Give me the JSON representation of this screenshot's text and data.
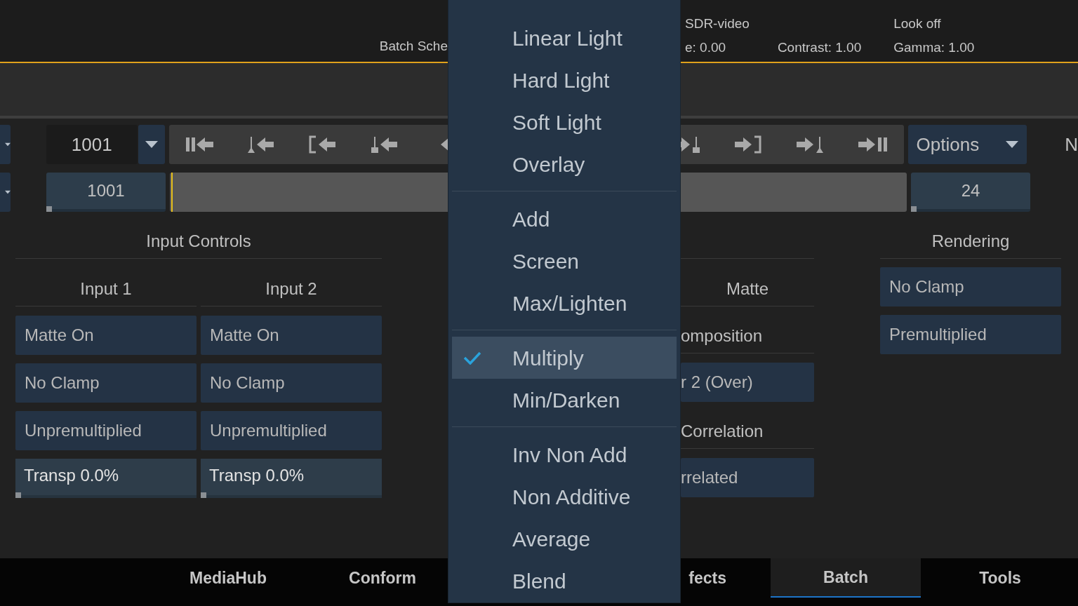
{
  "viewer_info": {
    "batch_label": "Batch Sche",
    "columns": [
      {
        "top": "SDR-video",
        "bottom": "e: 0.00"
      },
      {
        "bottom": "Contrast: 1.00"
      },
      {
        "top": "Look off",
        "bottom": "Gamma: 1.00"
      }
    ]
  },
  "frame_controls": {
    "current_frame": "1001",
    "start_frame": {
      "value": "1001",
      "level": 0
    },
    "end_frame": {
      "value": "24",
      "level": 0
    },
    "options_label": "Options",
    "cut_label": "N"
  },
  "input_controls": {
    "title": "Input Controls",
    "inputs": [
      {
        "title": "Input 1",
        "controls": [
          {
            "kind": "button",
            "label": "Matte On"
          },
          {
            "kind": "button",
            "label": "No Clamp"
          },
          {
            "kind": "button",
            "label": "Unpremultiplied"
          },
          {
            "kind": "slider",
            "label": "Transp 0.0%",
            "level": 0
          }
        ]
      },
      {
        "title": "Input 2",
        "controls": [
          {
            "kind": "button",
            "label": "Matte On"
          },
          {
            "kind": "button",
            "label": "No Clamp"
          },
          {
            "kind": "button",
            "label": "Unpremultiplied"
          },
          {
            "kind": "slider",
            "label": "Transp 0.0%",
            "level": 0
          }
        ]
      }
    ]
  },
  "matte_panel": {
    "rows": [
      {
        "kind": "header",
        "label": "Matte"
      },
      {
        "kind": "header",
        "label": "omposition"
      },
      {
        "kind": "button",
        "label": "r 2 (Over)"
      },
      {
        "kind": "header",
        "label": "Correlation"
      },
      {
        "kind": "button",
        "label": "rrelated"
      }
    ]
  },
  "rendering": {
    "title": "Rendering",
    "controls": [
      {
        "label": "No Clamp"
      },
      {
        "label": "Premultiplied"
      }
    ]
  },
  "blend_menu": [
    {
      "kind": "item",
      "label": "Linear Light",
      "selected": false
    },
    {
      "kind": "item",
      "label": "Hard Light",
      "selected": false
    },
    {
      "kind": "item",
      "label": "Soft Light",
      "selected": false
    },
    {
      "kind": "item",
      "label": "Overlay",
      "selected": false
    },
    {
      "kind": "separator"
    },
    {
      "kind": "item",
      "label": "Add",
      "selected": false
    },
    {
      "kind": "item",
      "label": "Screen",
      "selected": false
    },
    {
      "kind": "item",
      "label": "Max/Lighten",
      "selected": false
    },
    {
      "kind": "separator"
    },
    {
      "kind": "item",
      "label": "Multiply",
      "selected": true
    },
    {
      "kind": "item",
      "label": "Min/Darken",
      "selected": false
    },
    {
      "kind": "separator"
    },
    {
      "kind": "item",
      "label": "Inv Non Add",
      "selected": false
    },
    {
      "kind": "item",
      "label": "Non Additive",
      "selected": false
    },
    {
      "kind": "item",
      "label": "Average",
      "selected": false
    },
    {
      "kind": "item",
      "label": "Blend",
      "selected": false
    }
  ],
  "tabs": [
    {
      "label": "MediaHub",
      "selected": false
    },
    {
      "label": "Conform",
      "selected": false
    },
    {
      "label": "fects",
      "selected": false
    },
    {
      "label": "Batch",
      "selected": true
    },
    {
      "label": "Tools",
      "selected": false
    }
  ]
}
